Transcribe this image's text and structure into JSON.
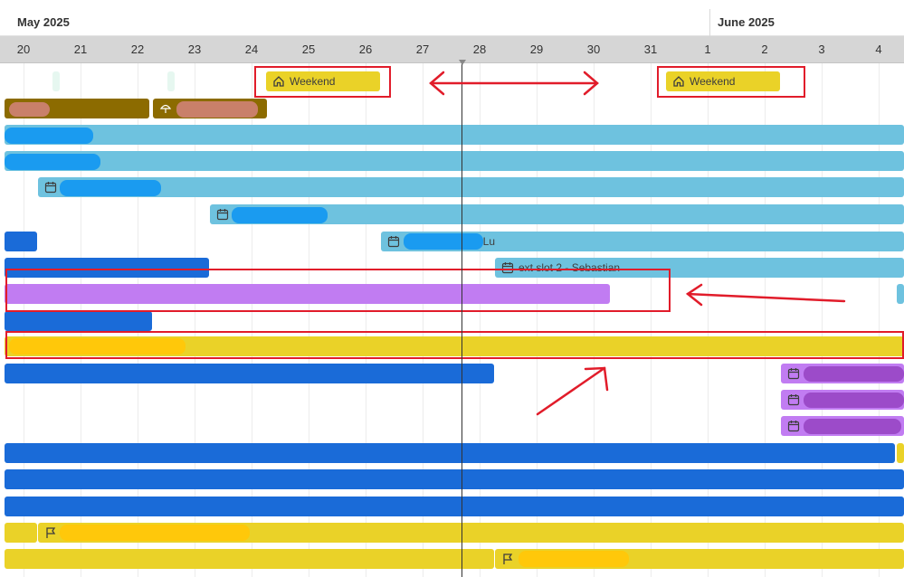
{
  "header": {
    "months": [
      "May 2025",
      "June 2025"
    ],
    "days": [
      "20",
      "21",
      "22",
      "23",
      "24",
      "25",
      "26",
      "27",
      "28",
      "29",
      "30",
      "31",
      "1",
      "2",
      "3",
      "4"
    ]
  },
  "events": {
    "weekend_label": "Weekend",
    "next_slot_label": "ext slot 2 - Sebastian",
    "partial_label": "–Lu"
  },
  "colors": {
    "light_blue": "#6ec2df",
    "dark_blue": "#1a6bd8",
    "yellow": "#ead228",
    "purple": "#c17cf2",
    "brown": "#8c6b00",
    "annotation_red": "#e11c2a"
  },
  "icons": [
    "home-icon",
    "calendar-icon",
    "umbrella-icon",
    "flag-icon"
  ]
}
